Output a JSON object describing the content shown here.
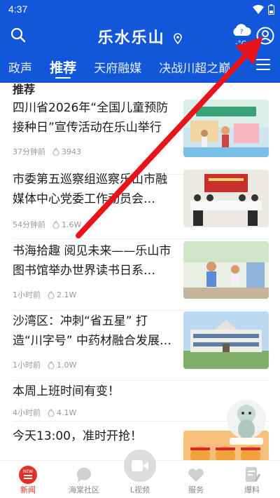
{
  "status_bar": {
    "time": "4:37"
  },
  "header": {
    "logo_text": "乐水乐山",
    "weather_temp": "-°C",
    "tabs": [
      {
        "label": "政声"
      },
      {
        "label": "推荐"
      },
      {
        "label": "天府融媒"
      },
      {
        "label": "决战川超之巅"
      }
    ]
  },
  "feed": {
    "section_title": "推荐",
    "items": [
      {
        "title": "四川省2026年“全国儿童预防接种日”宣传活动在乐山举行",
        "time": "37分钟前",
        "views": "3943"
      },
      {
        "title": "市委第五巡察组巡察乐山市融媒体中心党委工作动员会…",
        "time": "54分钟前",
        "views": "1.6W"
      },
      {
        "title": "书海拾趣 阅见未来——乐山市图书馆举办世界读书日系…",
        "time": "1小时前",
        "views": "2.1W"
      },
      {
        "title": "沙湾区：冲刺“省五星” 打造“川字号” 中药材融合发展…",
        "time": "1小时前",
        "views": "1.0W"
      },
      {
        "title": "本周上班时间有变！",
        "time": "4小时前",
        "views": "4.1W"
      },
      {
        "title": "今天13:00，准时开抢！",
        "time": "",
        "views": ""
      }
    ]
  },
  "tabbar": {
    "items": [
      {
        "label": "新闻",
        "badge": "NEW"
      },
      {
        "label": "海棠社区"
      },
      {
        "label": "L视频"
      },
      {
        "label": "服务"
      },
      {
        "label": "爆料"
      }
    ]
  },
  "colors": {
    "brand_blue": "#1257d9",
    "accent_red": "#e0302a",
    "arrow_red": "#e8141c"
  }
}
